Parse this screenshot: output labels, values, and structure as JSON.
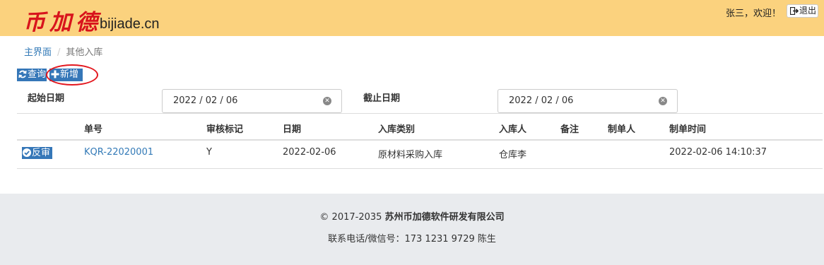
{
  "header": {
    "logo_cn": "币加德",
    "logo_en": "bijiade.cn",
    "welcome": "张三，欢迎！",
    "logout_label": "退出"
  },
  "breadcrumb": {
    "home": "主界面",
    "separator": "/",
    "current": "其他入库"
  },
  "toolbar": {
    "query_label": "查询",
    "add_label": "新增"
  },
  "filters": {
    "start_label": "起始日期",
    "start_value": "2022 / 02 / 06",
    "end_label": "截止日期",
    "end_value": "2022 / 02 / 06"
  },
  "table": {
    "columns": [
      "单号",
      "审核标记",
      "日期",
      "入库类别",
      "入库人",
      "备注",
      "制单人",
      "制单时间"
    ],
    "rows": [
      {
        "action": "反审",
        "cells": [
          "KQR-22020001",
          "Y",
          "2022-02-06",
          "原材料采购入库",
          "仓库李",
          "",
          "",
          "2022-02-06 14:10:37"
        ]
      }
    ]
  },
  "footer": {
    "copyright_prefix": "© 2017-2035",
    "company": "苏州币加德软件研发有限公司",
    "contact": "联系电话/微信号：173 1231 9729 陈生"
  },
  "colors": {
    "header_bg": "#fbd27e",
    "logo_red": "#d8141c",
    "button_blue": "#3577b8",
    "link_blue": "#337ab7",
    "highlight_red": "#e3171e",
    "footer_bg": "#e9ebee"
  },
  "icons": {
    "query": "refresh-icon",
    "add": "plus-icon",
    "logout": "sign-out-icon",
    "review": "check-circle-icon",
    "clear": "clear-circle-icon"
  }
}
